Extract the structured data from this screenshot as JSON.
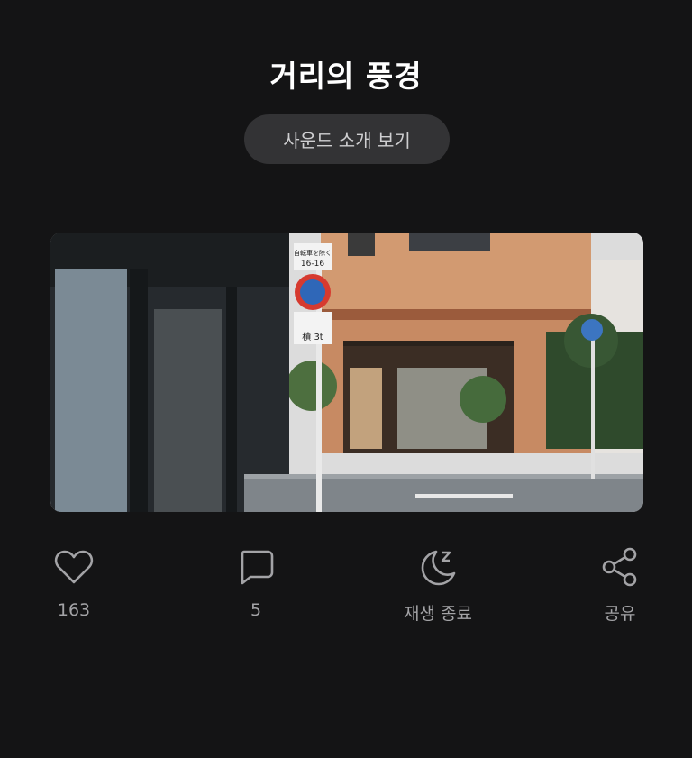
{
  "header": {
    "title": "거리의 풍경"
  },
  "intro_button": {
    "label": "사운드 소개 보기"
  },
  "artwork": {
    "description_icon": "street-photo",
    "signs": {
      "sign_top": "自転車を除く",
      "sign_time": "16-16",
      "sign_truck": "積 3t"
    }
  },
  "actions": [
    {
      "icon": "heart-icon",
      "label": "163"
    },
    {
      "icon": "comment-icon",
      "label": "5"
    },
    {
      "icon": "moon-sleep-icon",
      "label": "재생 종료"
    },
    {
      "icon": "share-icon",
      "label": "공유"
    }
  ],
  "colors": {
    "background": "#141415",
    "button_bg": "#333335",
    "icon_gray": "#a3a3a6"
  }
}
